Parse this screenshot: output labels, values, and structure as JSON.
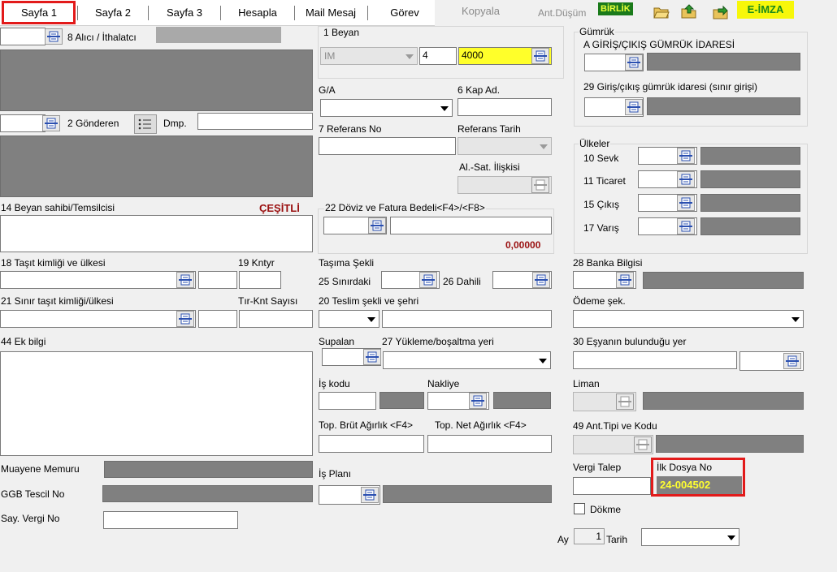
{
  "tabs": [
    {
      "label": "Sayfa 1"
    },
    {
      "label": "Sayfa 2"
    },
    {
      "label": "Sayfa 3"
    },
    {
      "label": "Hesapla"
    },
    {
      "label": "Mail Mesaj"
    },
    {
      "label": "Görev"
    }
  ],
  "toolbar": {
    "kopyala": "Kopyala",
    "ant_dusum": "Ant.Düşüm",
    "birlik": "BİRLİK",
    "eimza": "E-İMZA"
  },
  "left": {
    "alici": "8 Alıcı / İthalatcı",
    "gonderen": "2 Gönderen",
    "dmp": "Dmp.",
    "beyan_sahibi": "14 Beyan sahibi/Temsilcisi",
    "cesitli": "ÇEŞİTLİ",
    "tasit": "18 Taşıt kimliği ve ülkesi",
    "kntyr": "19 Kntyr",
    "sinir_tasit": "21 Sınır taşıt kimliği/ülkesi",
    "tir_knt": "Tır-Knt Sayısı",
    "ek_bilgi": "44 Ek bilgi",
    "muayene": "Muayene Memuru",
    "ggb": "GGB Tescil No",
    "say_vergi": "Say. Vergi No"
  },
  "middle": {
    "beyan": "1 Beyan",
    "beyan_type": "IM",
    "beyan_num": "4",
    "beyan_code": "4000",
    "ga": "G/A",
    "kap_ad": "6 Kap Ad.",
    "referans_no": "7 Referans No",
    "referans_tarih": "Referans Tarih",
    "al_sat": "Al.-Sat. İlişkisi",
    "doviz": "22 Döviz ve Fatura Bedeli<F4>/<F8>",
    "doviz_amount": "0,00000",
    "tasima": "Taşıma Şekli",
    "sinirdaki": "25 Sınırdaki",
    "dahili": "26 Dahili",
    "teslim": "20 Teslim şekli ve şehri",
    "supalan": "Supalan",
    "yukleme": "27 Yükleme/boşaltma yeri",
    "is_kodu": "İş kodu",
    "nakliye": "Nakliye",
    "brut": "Top. Brüt Ağırlık <F4>",
    "net": "Top. Net Ağırlık <F4>",
    "is_plani": "İş Planı"
  },
  "right": {
    "gumruk": "Gümrük",
    "giris_cikis": "A GİRİŞ/ÇIKIŞ GÜMRÜK İDARESİ",
    "sinir_girisi": "29 Giriş/çıkış gümrük idaresi (sınır girişi)",
    "ulkeler": "Ülkeler",
    "sevk": "10 Sevk",
    "ticaret": "11 Ticaret",
    "cikis": "15 Çıkış",
    "varis": "17 Varış",
    "banka": "28 Banka Bilgisi",
    "odeme": "Ödeme şek.",
    "esya_yer": "30 Eşyanın bulunduğu yer",
    "liman": "Liman",
    "ant_tipi": "49 Ant.Tipi ve Kodu",
    "vergi_talep": "Vergi Talep",
    "ilk_dosya": "İlk Dosya No",
    "ilk_dosya_value": "24-004502",
    "dokme": "Dökme",
    "ay": "Ay",
    "ay_value": "1",
    "tarih": "Tarih"
  }
}
